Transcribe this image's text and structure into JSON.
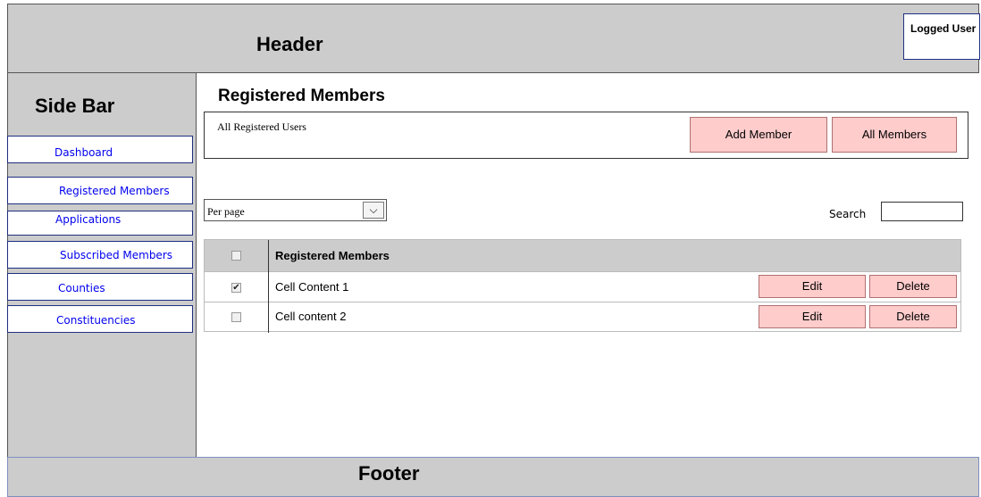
{
  "header": {
    "title": "Header",
    "logged_user": "Logged User"
  },
  "sidebar": {
    "title": "Side Bar",
    "items": [
      {
        "label": "Dashboard"
      },
      {
        "label": "Registered Members"
      },
      {
        "label": "Applications"
      },
      {
        "label": "Subscribed Members"
      },
      {
        "label": "Counties"
      },
      {
        "label": "Constituencies"
      }
    ]
  },
  "main": {
    "title": "Registered Members",
    "panel_text": "All Registered Users",
    "add_member_label": "Add Member",
    "all_members_label": "All Members",
    "per_page_label": "Per page",
    "dropdown_arrow": "⌵",
    "search_label": "Search",
    "search_value": "",
    "table": {
      "header": "Registered Members",
      "rows": [
        {
          "text": "Cell Content 1",
          "checked": true,
          "check_mark": "✔",
          "edit": "Edit",
          "delete": "Delete"
        },
        {
          "text": "Cell content 2",
          "checked": false,
          "check_mark": "",
          "edit": "Edit",
          "delete": "Delete"
        }
      ]
    }
  },
  "footer": {
    "title": "Footer"
  },
  "colors": {
    "panel_gray": "#cccccc",
    "button_pink": "#ffcccc",
    "link_blue": "#0000ee",
    "border_navy": "#1f2f80"
  }
}
